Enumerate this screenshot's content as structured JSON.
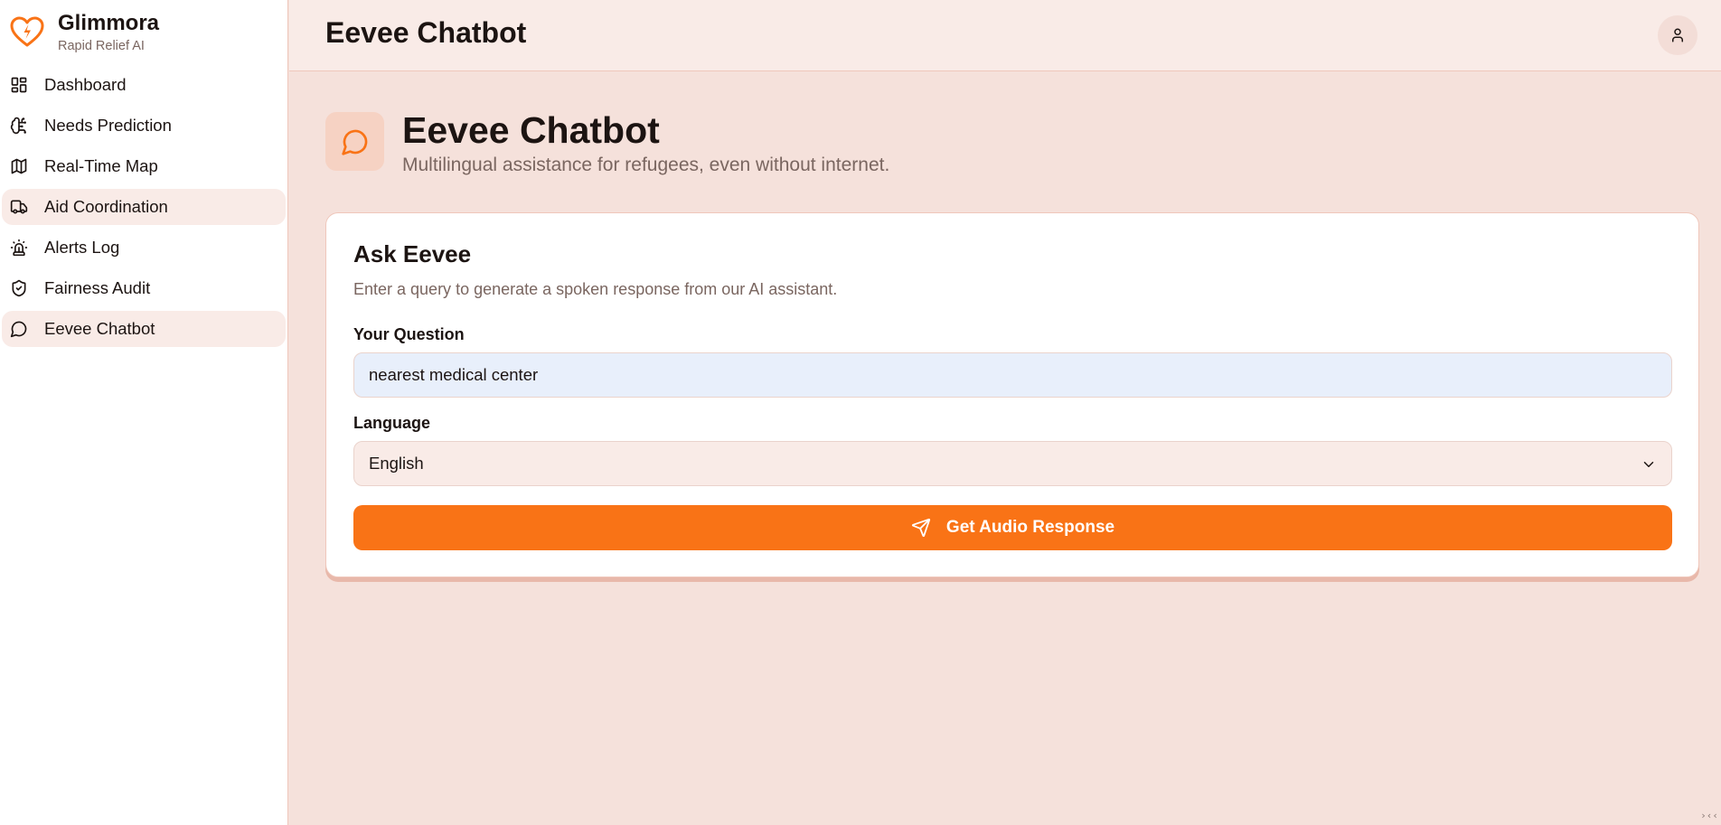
{
  "brand": {
    "name": "Glimmora",
    "tagline": "Rapid Relief AI",
    "logo_icon": "heart-bolt-icon",
    "accent_color": "#f97316"
  },
  "sidebar": {
    "items": [
      {
        "label": "Dashboard",
        "icon": "dashboard-icon",
        "active": false
      },
      {
        "label": "Needs Prediction",
        "icon": "brain-icon",
        "active": false
      },
      {
        "label": "Real-Time Map",
        "icon": "map-icon",
        "active": false
      },
      {
        "label": "Aid Coordination",
        "icon": "truck-icon",
        "active": true
      },
      {
        "label": "Alerts Log",
        "icon": "siren-icon",
        "active": false
      },
      {
        "label": "Fairness Audit",
        "icon": "shield-check-icon",
        "active": false
      },
      {
        "label": "Eevee Chatbot",
        "icon": "message-circle-icon",
        "active": true
      }
    ]
  },
  "topbar": {
    "title": "Eevee Chatbot",
    "user_icon": "user-icon"
  },
  "header": {
    "icon": "message-circle-icon",
    "title": "Eevee Chatbot",
    "subtitle": "Multilingual assistance for refugees, even without internet."
  },
  "card": {
    "title": "Ask Eevee",
    "description": "Enter a query to generate a spoken response from our AI assistant.",
    "question_label": "Your Question",
    "question_value": "nearest medical center",
    "language_label": "Language",
    "language_value": "English",
    "submit_label": "Get Audio Response",
    "submit_icon": "send-icon"
  },
  "corner": {
    "mark": "›‹‹"
  }
}
